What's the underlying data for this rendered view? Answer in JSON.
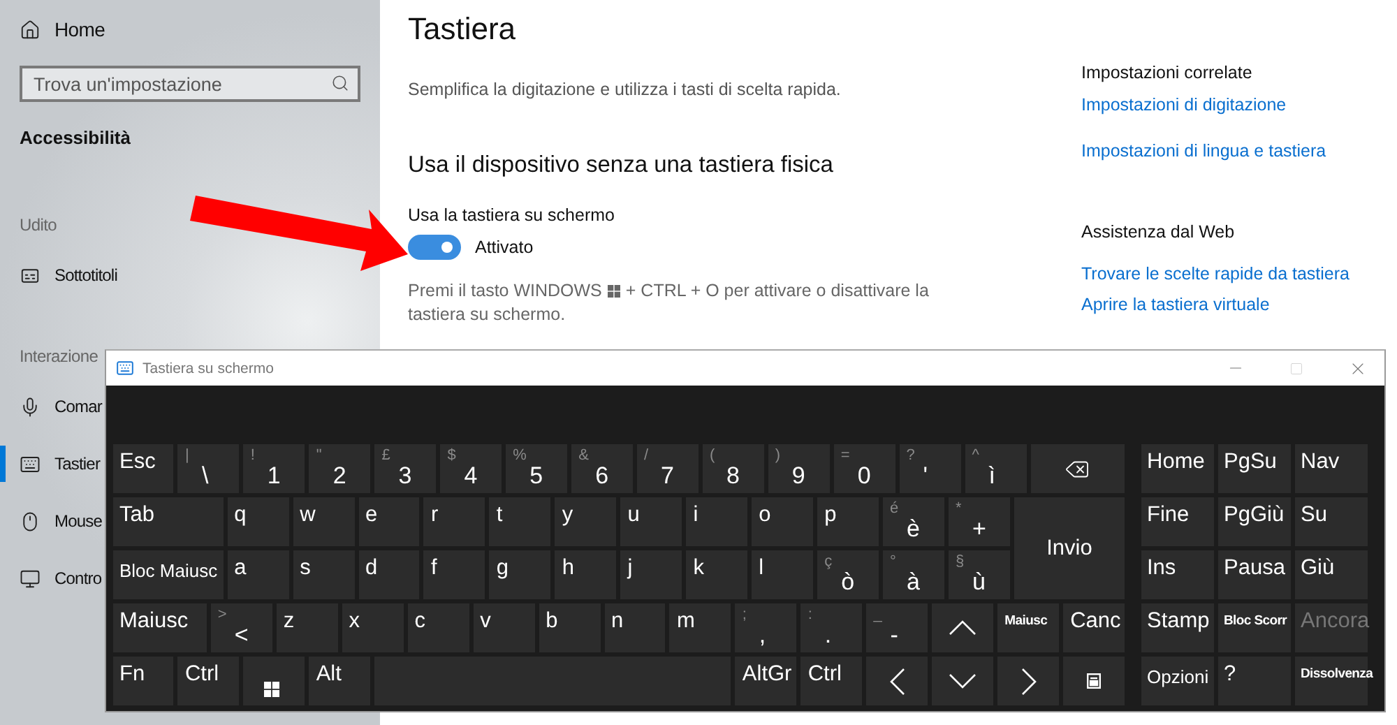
{
  "sidebar": {
    "home": "Home",
    "search": {
      "placeholder": "Trova un'impostazione"
    },
    "section": "Accessibilità",
    "groups": [
      {
        "title": "Udito",
        "items": [
          {
            "label": "Sottotitoli",
            "selected": false
          }
        ]
      },
      {
        "title": "Interazione",
        "items": [
          {
            "label": "Comar",
            "selected": false
          },
          {
            "label": "Tastier",
            "selected": true
          },
          {
            "label": "Mouse",
            "selected": false
          },
          {
            "label": "Contro",
            "selected": false
          }
        ]
      }
    ]
  },
  "page": {
    "title": "Tastiera",
    "subtitle": "Semplifica la digitazione e utilizza i tasti di scelta rapida.",
    "heading": "Usa il dispositivo senza una tastiera fisica",
    "setting": {
      "label": "Usa la tastiera su schermo",
      "on": true,
      "state": "Attivato"
    },
    "hint": {
      "before": "Premi il tasto WINDOWS",
      "after": "+ CTRL + O per attivare o disattivare la",
      "next_line": "tastiera su schermo."
    }
  },
  "related": [
    {
      "title": "Impostazioni correlate",
      "links": [
        "Impostazioni di digitazione",
        "Impostazioni di lingua e tastiera"
      ]
    },
    {
      "title": "Assistenza dal Web",
      "links": [
        "Trovare le scelte rapide da tastiera",
        "Aprire la tastiera virtuale"
      ]
    }
  ],
  "keyboard_window": {
    "title": "Tastiera su schermo",
    "rows": [
      {
        "keys": [
          {
            "kind": "key",
            "label": "Esc"
          },
          {
            "kind": "key",
            "label": "\\",
            "shift": "|"
          },
          {
            "kind": "key",
            "label": "1",
            "shift": "!"
          },
          {
            "kind": "key",
            "label": "2",
            "shift": "\""
          },
          {
            "kind": "key",
            "label": "3",
            "shift": "£"
          },
          {
            "kind": "key",
            "label": "4",
            "shift": "$"
          },
          {
            "kind": "key",
            "label": "5",
            "shift": "%"
          },
          {
            "kind": "key",
            "label": "6",
            "shift": "&"
          },
          {
            "kind": "key",
            "label": "7",
            "shift": "/"
          },
          {
            "kind": "key",
            "label": "8",
            "shift": "("
          },
          {
            "kind": "key",
            "label": "9",
            "shift": ")"
          },
          {
            "kind": "key",
            "label": "0",
            "shift": "="
          },
          {
            "kind": "key",
            "label": "'",
            "shift": "?"
          },
          {
            "kind": "key",
            "label": "ì",
            "shift": "^"
          },
          {
            "kind": "backspace"
          }
        ]
      },
      {
        "keys": [
          {
            "kind": "key",
            "label": "Tab"
          },
          {
            "kind": "key",
            "label": "q"
          },
          {
            "kind": "key",
            "label": "w"
          },
          {
            "kind": "key",
            "label": "e"
          },
          {
            "kind": "key",
            "label": "r"
          },
          {
            "kind": "key",
            "label": "t"
          },
          {
            "kind": "key",
            "label": "y"
          },
          {
            "kind": "key",
            "label": "u"
          },
          {
            "kind": "key",
            "label": "i"
          },
          {
            "kind": "key",
            "label": "o"
          },
          {
            "kind": "key",
            "label": "p"
          },
          {
            "kind": "key",
            "label": "è",
            "shift": "é"
          },
          {
            "kind": "key",
            "label": "+",
            "shift": "*"
          },
          {
            "kind": "enter",
            "label": "Invio"
          }
        ]
      },
      {
        "keys": [
          {
            "kind": "mid",
            "label": "Bloc Maiusc"
          },
          {
            "kind": "key",
            "label": "a"
          },
          {
            "kind": "key",
            "label": "s"
          },
          {
            "kind": "key",
            "label": "d"
          },
          {
            "kind": "key",
            "label": "f"
          },
          {
            "kind": "key",
            "label": "g"
          },
          {
            "kind": "key",
            "label": "h"
          },
          {
            "kind": "key",
            "label": "j"
          },
          {
            "kind": "key",
            "label": "k"
          },
          {
            "kind": "key",
            "label": "l"
          },
          {
            "kind": "key",
            "label": "ò",
            "shift": "ç"
          },
          {
            "kind": "key",
            "label": "à",
            "shift": "°"
          },
          {
            "kind": "key",
            "label": "ù",
            "shift": "§"
          }
        ]
      },
      {
        "keys": [
          {
            "kind": "key",
            "label": "Maiusc"
          },
          {
            "kind": "key",
            "label": "<",
            "shift": ">"
          },
          {
            "kind": "key",
            "label": "z"
          },
          {
            "kind": "key",
            "label": "x"
          },
          {
            "kind": "key",
            "label": "c"
          },
          {
            "kind": "key",
            "label": "v"
          },
          {
            "kind": "key",
            "label": "b"
          },
          {
            "kind": "key",
            "label": "n"
          },
          {
            "kind": "key",
            "label": "m"
          },
          {
            "kind": "key",
            "label": ",",
            "shift": ";"
          },
          {
            "kind": "key",
            "label": ".",
            "shift": ":"
          },
          {
            "kind": "key",
            "label": "-",
            "shift": "_"
          },
          {
            "kind": "up"
          },
          {
            "kind": "small",
            "label": "Maiusc"
          },
          {
            "kind": "key",
            "label": "Canc"
          }
        ]
      },
      {
        "keys": [
          {
            "kind": "key",
            "label": "Fn"
          },
          {
            "kind": "key",
            "label": "Ctrl"
          },
          {
            "kind": "windows"
          },
          {
            "kind": "key",
            "label": "Alt"
          },
          {
            "kind": "space"
          },
          {
            "kind": "key",
            "label": "AltGr"
          },
          {
            "kind": "key",
            "label": "Ctrl"
          },
          {
            "kind": "left"
          },
          {
            "kind": "down"
          },
          {
            "kind": "right"
          },
          {
            "kind": "menu"
          }
        ]
      }
    ],
    "nav": [
      {
        "kind": "key",
        "label": "Home",
        "disabled": false
      },
      {
        "kind": "key",
        "label": "PgSu",
        "disabled": false
      },
      {
        "kind": "key",
        "label": "Nav",
        "disabled": false
      },
      {
        "kind": "key",
        "label": "Fine",
        "disabled": false
      },
      {
        "kind": "key",
        "label": "PgGiù",
        "disabled": false
      },
      {
        "kind": "key",
        "label": "Su",
        "disabled": false
      },
      {
        "kind": "key",
        "label": "Ins",
        "disabled": false
      },
      {
        "kind": "key",
        "label": "Pausa",
        "disabled": false
      },
      {
        "kind": "key",
        "label": "Giù",
        "disabled": false
      },
      {
        "kind": "key",
        "label": "Stamp",
        "disabled": false
      },
      {
        "kind": "small",
        "label": "Bloc Scorr",
        "disabled": false
      },
      {
        "kind": "key",
        "label": "Ancora",
        "disabled": true
      },
      {
        "kind": "mid",
        "label": "Opzioni",
        "disabled": false
      },
      {
        "kind": "key",
        "label": "?",
        "disabled": false
      },
      {
        "kind": "small",
        "label": "Dissolvenza",
        "disabled": false
      }
    ]
  }
}
